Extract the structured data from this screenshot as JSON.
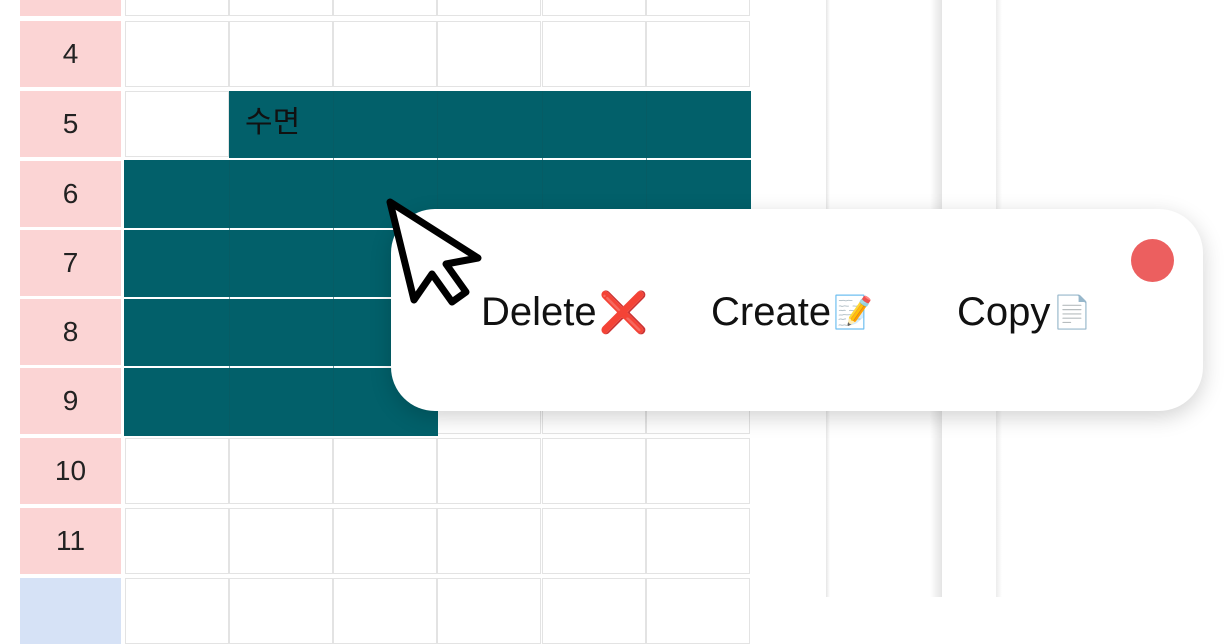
{
  "rows": [
    {
      "num": ""
    },
    {
      "num": "4"
    },
    {
      "num": "5"
    },
    {
      "num": "6"
    },
    {
      "num": "7"
    },
    {
      "num": "8"
    },
    {
      "num": "9"
    },
    {
      "num": "10"
    },
    {
      "num": "11"
    },
    {
      "num": ""
    }
  ],
  "event": {
    "label": "수면",
    "color": "#02606a"
  },
  "popup": {
    "delete_label": "Delete",
    "delete_icon": "❌",
    "create_label": "Create",
    "create_icon": "📝",
    "copy_label": "Copy",
    "copy_icon": "📄",
    "close_color": "#ec5f5f"
  },
  "colors": {
    "row_header": "#fbd4d4",
    "row_header_alt": "#d6e2f6"
  }
}
